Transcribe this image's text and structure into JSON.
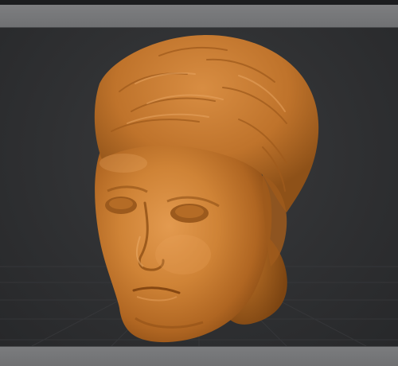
{
  "app": {
    "viewport_background": "#2f3032",
    "toolbar_color": "#747577"
  },
  "model": {
    "icon": "sculpted-head-mesh",
    "material_color": "#c87a2d",
    "shadow_color": "#8a4e14",
    "highlight_color": "#e8a35a"
  }
}
